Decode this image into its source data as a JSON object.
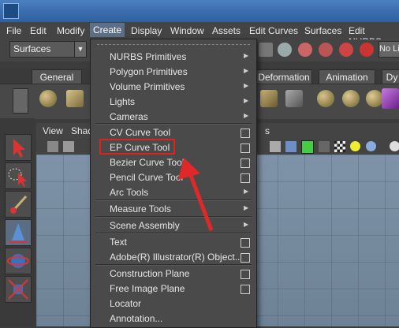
{
  "menubar": {
    "items": [
      "File",
      "Edit",
      "Modify",
      "Create",
      "Display",
      "Window",
      "Assets",
      "Edit Curves",
      "Surfaces",
      "Edit NURBS"
    ],
    "active": "Create"
  },
  "toolbar": {
    "mode_select": "Surfaces",
    "right_text": "No Li"
  },
  "shelf": {
    "tabs": [
      "General",
      "Deformation",
      "Animation",
      "Dy"
    ]
  },
  "panel": {
    "menus": [
      "View",
      "Shad",
      "s"
    ]
  },
  "create_menu": {
    "items": [
      {
        "label": "NURBS Primitives",
        "has_submenu": true
      },
      {
        "label": "Polygon Primitives",
        "has_submenu": true
      },
      {
        "label": "Volume Primitives",
        "has_submenu": true
      },
      {
        "label": "Lights",
        "has_submenu": true
      },
      {
        "label": "Cameras",
        "has_submenu": true
      },
      {
        "label": "CV Curve Tool",
        "has_option": true
      },
      {
        "label": "EP Curve Tool",
        "has_option": true
      },
      {
        "label": "Bezier Curve Tool",
        "has_option": true
      },
      {
        "label": "Pencil Curve Tool",
        "has_option": true
      },
      {
        "label": "Arc Tools",
        "has_submenu": true
      },
      {
        "label": "Measure Tools",
        "has_submenu": true
      },
      {
        "label": "Scene Assembly",
        "has_submenu": true
      },
      {
        "label": "Text",
        "has_option": true
      },
      {
        "label": "Adobe(R) Illustrator(R) Object...",
        "has_option": true
      },
      {
        "label": "Construction Plane",
        "has_option": true
      },
      {
        "label": "Free Image Plane",
        "has_option": true
      },
      {
        "label": "Locator"
      },
      {
        "label": "Annotation..."
      }
    ],
    "highlighted": "EP Curve Tool"
  },
  "colors": {
    "highlight_box": "#d22222",
    "arrow": "#e02828"
  }
}
